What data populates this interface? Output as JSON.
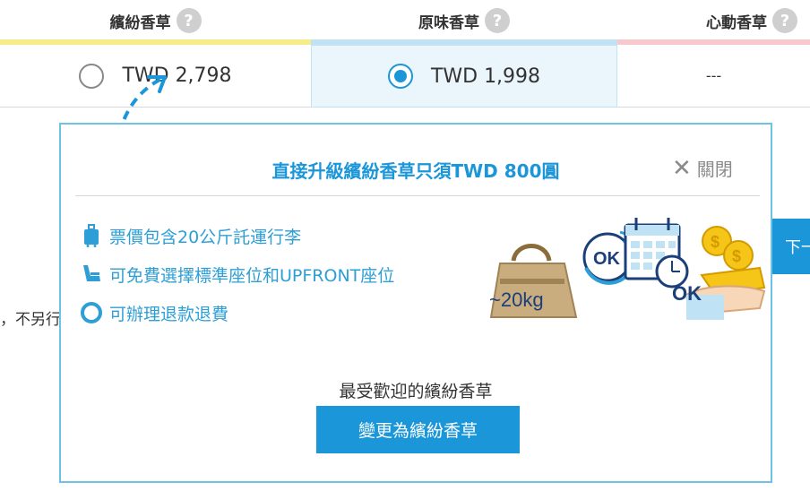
{
  "columns": [
    {
      "name": "繽紛香草",
      "help": "?",
      "bar_color": "#f7ec8a"
    },
    {
      "name": "原味香草",
      "help": "?",
      "bar_color": "#bfe2f4"
    },
    {
      "name": "心動香草",
      "help": "?",
      "bar_color": "#f7c9cc"
    }
  ],
  "prices": [
    {
      "value": "TWD 2,798",
      "selected": false
    },
    {
      "value": "TWD 1,998",
      "selected": true
    },
    {
      "value": "---"
    }
  ],
  "left_text": "，不另行",
  "next_button": "下一",
  "popup": {
    "title": "直接升級繽紛香草只須TWD 800圓",
    "close_label": "關閉",
    "features": [
      {
        "text": "票價包含20公斤託運行李",
        "icon": "luggage-icon"
      },
      {
        "text": "可免費選擇標準座位和UPFRONT座位",
        "icon": "seat-icon"
      },
      {
        "text": "可辦理退款退費",
        "icon": "circle-icon"
      }
    ],
    "illustration": {
      "bag_label": "~20kg",
      "ok_label": "OK",
      "ok_label2": "OK"
    },
    "popular_text": "最受歡迎的繽紛香草",
    "cta_label": "變更為繽紛香草"
  }
}
